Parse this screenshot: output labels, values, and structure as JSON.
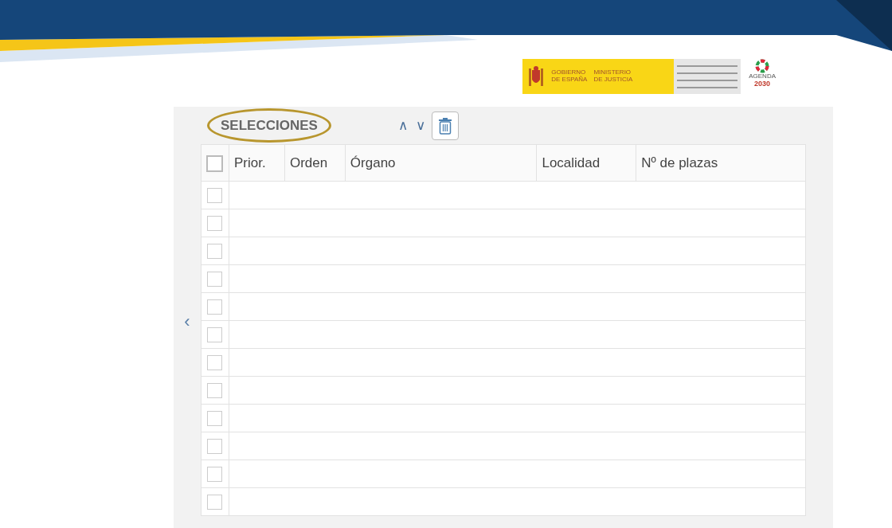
{
  "logos": {
    "government": "GOBIERNO\nDE ESPAÑA",
    "ministry": "MINISTERIO\nDE JUSTICIA",
    "agenda": "AGENDA",
    "agenda_year": "2030"
  },
  "panel": {
    "title": "SELECCIONES",
    "title_highlighted": true,
    "move_up": "∧",
    "move_down": "∨",
    "collapse": "‹"
  },
  "table": {
    "select_all": {
      "checked": false
    },
    "columns": [
      "Prior.",
      "Orden",
      "Órgano",
      "Localidad",
      "Nº de plazas"
    ],
    "rows": [
      {
        "checked": false
      },
      {
        "checked": false
      },
      {
        "checked": false
      },
      {
        "checked": false
      },
      {
        "checked": false
      },
      {
        "checked": false
      },
      {
        "checked": false
      },
      {
        "checked": false
      },
      {
        "checked": false
      },
      {
        "checked": false
      },
      {
        "checked": false
      },
      {
        "checked": false
      }
    ]
  }
}
